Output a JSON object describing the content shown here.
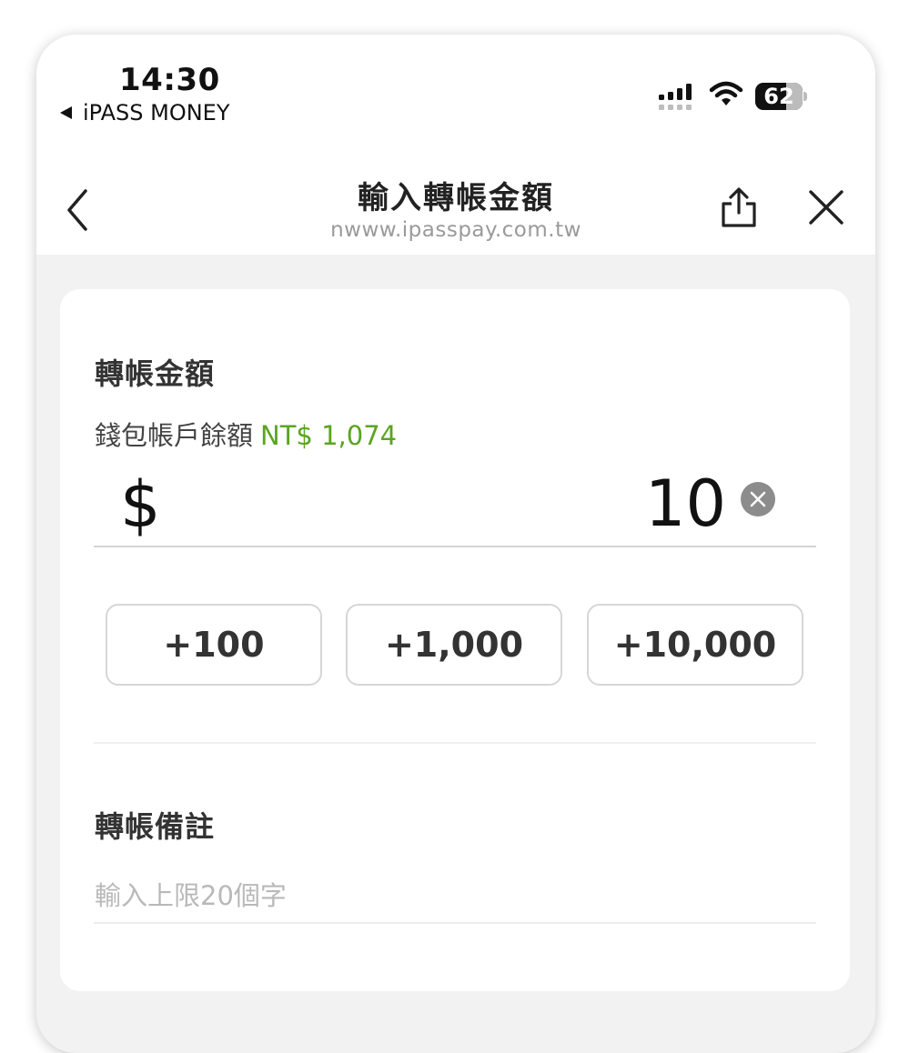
{
  "status_bar": {
    "time": "14:30",
    "back_app": "iPASS MONEY",
    "battery": "62"
  },
  "nav": {
    "title": "輸入轉帳金額",
    "url": "nwww.ipasspay.com.tw"
  },
  "amount_section": {
    "title": "轉帳金額",
    "balance_label": "錢包帳戶餘額",
    "balance_value": "NT$ 1,074",
    "currency_symbol": "$",
    "amount_value": "10"
  },
  "quick_amounts": [
    "+100",
    "+1,000",
    "+10,000"
  ],
  "note_section": {
    "title": "轉帳備註",
    "placeholder": "輸入上限20個字"
  },
  "colors": {
    "accent_green": "#5aa51f",
    "background": "#f2f2f2"
  }
}
